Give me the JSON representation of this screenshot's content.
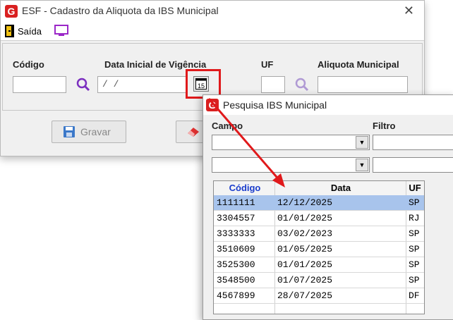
{
  "main_window": {
    "title": "ESF - Cadastro da Aliquota da IBS Municipal",
    "close_glyph": "✕",
    "toolbar": {
      "exit_label": "Saída"
    },
    "labels": {
      "codigo": "Código",
      "data_inicial": "Data Inicial de Vigência",
      "uf": "UF",
      "aliquota": "Aliquota Municipal"
    },
    "fields": {
      "codigo_value": "",
      "data_inicial_value": "/ /",
      "calendar_glyph": "15",
      "uf_value": "",
      "aliquota_value": ""
    },
    "buttons": {
      "save_label": "Gravar"
    }
  },
  "search_window": {
    "title": "Pesquisa IBS Municipal",
    "labels": {
      "campo": "Campo",
      "filtro": "Filtro"
    },
    "grid": {
      "headers": [
        "Código",
        "Data",
        "UF"
      ],
      "rows": [
        [
          "1111111",
          "12/12/2025",
          "SP"
        ],
        [
          "3304557",
          "01/01/2025",
          "RJ"
        ],
        [
          "3333333",
          "03/02/2023",
          "SP"
        ],
        [
          "3510609",
          "01/05/2025",
          "SP"
        ],
        [
          "3525300",
          "01/01/2025",
          "SP"
        ],
        [
          "3548500",
          "01/07/2025",
          "SP"
        ],
        [
          "4567899",
          "28/07/2025",
          "DF"
        ]
      ],
      "selected_row": 0
    }
  },
  "colors": {
    "accent_red": "#e0191b",
    "header_blue": "#1a3ccc",
    "selection": "#a8c4ec",
    "magnifier_purple": "#7b2fbf"
  }
}
